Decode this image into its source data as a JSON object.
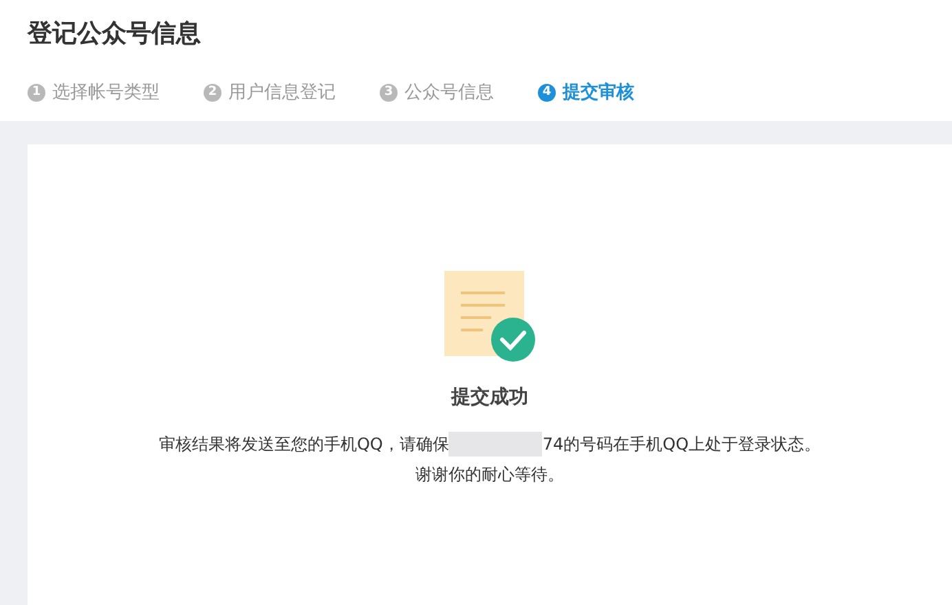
{
  "page": {
    "title": "登记公众号信息"
  },
  "steps": [
    {
      "number": "1",
      "label": "选择帐号类型",
      "selected": false
    },
    {
      "number": "2",
      "label": "用户信息登记",
      "selected": false
    },
    {
      "number": "3",
      "label": "公众号信息",
      "selected": false
    },
    {
      "number": "4",
      "label": "提交审核",
      "selected": true
    }
  ],
  "result": {
    "title": "提交成功",
    "message_before": "审核结果将发送至您的手机QQ，请确保",
    "message_after": "74的号码在手机QQ上处于登录状态。",
    "thanks": "谢谢你的耐心等待。"
  }
}
